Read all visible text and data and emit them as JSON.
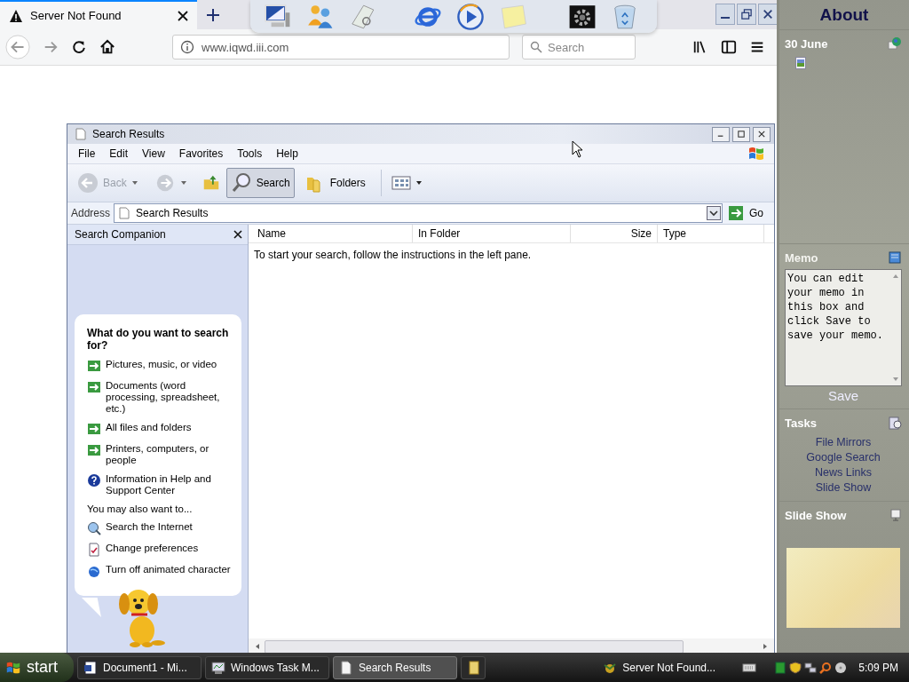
{
  "browser": {
    "tab_title": "Server Not Found",
    "url": "www.iqwd.iii.com",
    "search_placeholder": "Search"
  },
  "explorer": {
    "title": "Search Results",
    "menu": [
      "File",
      "Edit",
      "View",
      "Favorites",
      "Tools",
      "Help"
    ],
    "toolbar": [
      {
        "kind": "back",
        "label": "Back",
        "disabled": true
      },
      {
        "kind": "search",
        "label": "Search",
        "selected": true
      },
      {
        "kind": "folders",
        "label": "Folders",
        "selected": false
      }
    ],
    "address": {
      "label": "Address",
      "value": "Search Results",
      "go": "Go"
    },
    "companion": {
      "title": "Search Companion",
      "heading": "What do you want to search for?",
      "options": [
        {
          "kind": "arrow",
          "label": "Pictures, music, or video"
        },
        {
          "kind": "arrow",
          "label": "Documents (word processing, spreadsheet, etc.)"
        },
        {
          "kind": "arrow",
          "label": "All files and folders"
        },
        {
          "kind": "arrow",
          "label": "Printers, computers, or people"
        },
        {
          "kind": "help",
          "label": "Information in Help and Support Center"
        }
      ],
      "more_label": "You may also want to...",
      "more": [
        {
          "kind": "internet",
          "label": "Search the Internet"
        },
        {
          "kind": "prefs",
          "label": "Change preferences"
        },
        {
          "kind": "character",
          "label": "Turn off animated character"
        }
      ]
    },
    "columns": [
      "Name",
      "In Folder",
      "Size",
      "Type"
    ],
    "message": "To start your search, follow the instructions in the left pane."
  },
  "sidebar": {
    "title": "About",
    "date": "30 June",
    "memo": {
      "title": "Memo",
      "value": "You can edit your memo in this box and click Save to save your memo.",
      "save": "Save"
    },
    "tasks": {
      "title": "Tasks",
      "items": [
        "File Mirrors",
        "Google Search",
        "News Links",
        "Slide Show"
      ]
    },
    "slideshow": {
      "title": "Slide Show"
    }
  },
  "taskbar": {
    "start": "start",
    "items": [
      {
        "kind": "word",
        "label": "Document1 - Mi...",
        "selected": false
      },
      {
        "kind": "taskmgr",
        "label": "Windows Task M...",
        "selected": false
      },
      {
        "kind": "folder",
        "label": "Search Results",
        "selected": true
      },
      {
        "kind": "note",
        "selected": false
      }
    ],
    "browser_item": "Server Not Found...",
    "clock": "5:09 PM"
  }
}
